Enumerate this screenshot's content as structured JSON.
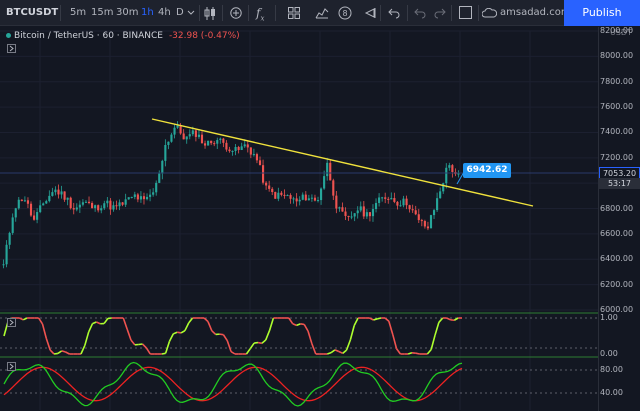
{
  "toolbar": {
    "symbol": "BTCUSDT",
    "intervals": [
      "5m",
      "15m",
      "30m",
      "1h",
      "4h",
      "D"
    ],
    "active_interval": "1h",
    "fx_label": "f",
    "fx_sub": "x",
    "alert_number": "8",
    "cloud_label": "amsadad.com",
    "publish_label": "Publish"
  },
  "legend": {
    "title": "Bitcoin / TetherUS · 60 · BINANCE",
    "change": "-32.98 (-0.47%)"
  },
  "callout": {
    "text": "6942.62"
  },
  "price_axis": {
    "currency": "USDT",
    "ticks": [
      "8200.00",
      "8000.00",
      "7800.00",
      "7600.00",
      "7400.00",
      "7200.00",
      "7000.00",
      "6800.00",
      "6600.00",
      "6400.00",
      "6200.00",
      "6000.00"
    ],
    "last_price": "7053.20",
    "countdown": "53:17"
  },
  "stoch_axis": {
    "ticks": [
      "1.00",
      "0.00"
    ]
  },
  "osc_axis": {
    "ticks": [
      "80.00",
      "40.00"
    ]
  },
  "colors": {
    "background": "#131722",
    "up": "#26a69a",
    "down": "#ef5350",
    "trendline": "#f0e23c",
    "stoch": "#adff2f",
    "osc_green": "#22cc22",
    "osc_red": "#ee2222",
    "accent": "#2962ff"
  },
  "chart_data": {
    "type": "line",
    "series": [
      {
        "values": [
          6350,
          6800,
          6900,
          6700,
          6850,
          6950,
          6900,
          6800,
          6850,
          6800,
          6850,
          6800,
          6850,
          6900,
          6850,
          6950,
          7300,
          7450,
          7350,
          7400,
          7300,
          7350,
          7300,
          7250,
          7300,
          7200,
          6950,
          6900,
          6900,
          6850,
          6900,
          6850,
          7150,
          6800,
          6700,
          6800,
          6750,
          6850,
          6900,
          6850,
          6850,
          6700,
          6650,
          6900,
          7150,
          7050
        ]
      }
    ],
    "ylim": [
      6000,
      8200
    ]
  }
}
